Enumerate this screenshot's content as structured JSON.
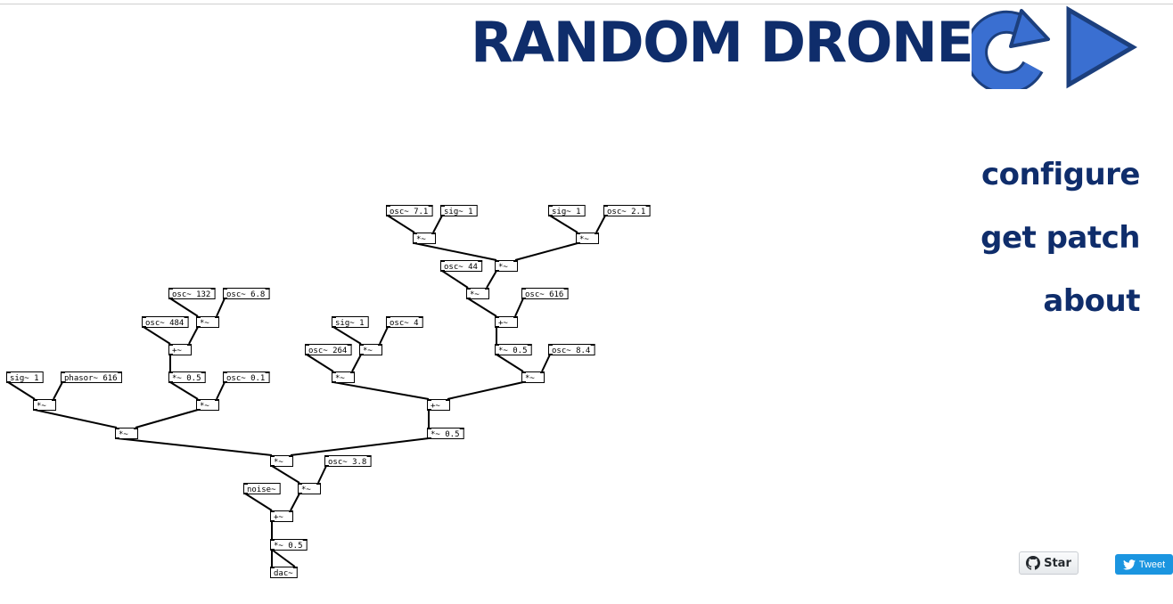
{
  "header": {
    "title": "RANDOM DRONE",
    "refresh_icon": "refresh-arrow-icon",
    "play_icon": "play-triangle-icon"
  },
  "nav": {
    "configure": "configure",
    "get_patch": "get patch",
    "about": "about"
  },
  "patch": {
    "boxes": [
      {
        "id": "b0",
        "label": "osc~ 7.1",
        "inlets": 2,
        "outlets": 1
      },
      {
        "id": "b1",
        "label": "sig~ 1",
        "inlets": 1,
        "outlets": 1
      },
      {
        "id": "b2",
        "label": "sig~ 1",
        "inlets": 1,
        "outlets": 1
      },
      {
        "id": "b3",
        "label": "osc~ 2.1",
        "inlets": 2,
        "outlets": 1
      },
      {
        "id": "b4",
        "label": "*~",
        "inlets": 2,
        "outlets": 1
      },
      {
        "id": "b5",
        "label": "*~",
        "inlets": 2,
        "outlets": 1
      },
      {
        "id": "b6",
        "label": "osc~ 44",
        "inlets": 2,
        "outlets": 1
      },
      {
        "id": "b7",
        "label": "*~",
        "inlets": 2,
        "outlets": 1
      },
      {
        "id": "b8",
        "label": "*~",
        "inlets": 2,
        "outlets": 1
      },
      {
        "id": "b9",
        "label": "osc~ 616",
        "inlets": 2,
        "outlets": 1
      },
      {
        "id": "b10",
        "label": "+~",
        "inlets": 2,
        "outlets": 1
      },
      {
        "id": "b11",
        "label": "*~ 0.5",
        "inlets": 2,
        "outlets": 1
      },
      {
        "id": "b12",
        "label": "osc~ 8.4",
        "inlets": 2,
        "outlets": 1
      },
      {
        "id": "b13",
        "label": "*~",
        "inlets": 2,
        "outlets": 1
      },
      {
        "id": "b14",
        "label": "osc~ 132",
        "inlets": 2,
        "outlets": 1
      },
      {
        "id": "b15",
        "label": "osc~ 6.8",
        "inlets": 2,
        "outlets": 1
      },
      {
        "id": "b16",
        "label": "osc~ 484",
        "inlets": 2,
        "outlets": 1
      },
      {
        "id": "b17",
        "label": "*~",
        "inlets": 2,
        "outlets": 1
      },
      {
        "id": "b18",
        "label": "+~",
        "inlets": 2,
        "outlets": 1
      },
      {
        "id": "b19",
        "label": "sig~ 1",
        "inlets": 1,
        "outlets": 1
      },
      {
        "id": "b20",
        "label": "osc~ 4",
        "inlets": 2,
        "outlets": 1
      },
      {
        "id": "b21",
        "label": "osc~ 264",
        "inlets": 2,
        "outlets": 1
      },
      {
        "id": "b22",
        "label": "*~",
        "inlets": 2,
        "outlets": 1
      },
      {
        "id": "b23",
        "label": "*~",
        "inlets": 2,
        "outlets": 1
      },
      {
        "id": "b24",
        "label": "sig~ 1",
        "inlets": 1,
        "outlets": 1
      },
      {
        "id": "b25",
        "label": "phasor~ 616",
        "inlets": 2,
        "outlets": 1
      },
      {
        "id": "b26",
        "label": "*~ 0.5",
        "inlets": 2,
        "outlets": 1
      },
      {
        "id": "b27",
        "label": "osc~ 0.1",
        "inlets": 2,
        "outlets": 1
      },
      {
        "id": "b28",
        "label": "*~",
        "inlets": 2,
        "outlets": 1
      },
      {
        "id": "b29",
        "label": "*~",
        "inlets": 2,
        "outlets": 1
      },
      {
        "id": "b30",
        "label": "+~",
        "inlets": 2,
        "outlets": 1
      },
      {
        "id": "b31",
        "label": "*~",
        "inlets": 2,
        "outlets": 1
      },
      {
        "id": "b32",
        "label": "*~ 0.5",
        "inlets": 2,
        "outlets": 1
      },
      {
        "id": "b33",
        "label": "*~",
        "inlets": 2,
        "outlets": 1
      },
      {
        "id": "b34",
        "label": "osc~ 3.8",
        "inlets": 2,
        "outlets": 1
      },
      {
        "id": "b35",
        "label": "*~",
        "inlets": 2,
        "outlets": 1
      },
      {
        "id": "b36",
        "label": "noise~",
        "inlets": 1,
        "outlets": 1
      },
      {
        "id": "b37",
        "label": "+~",
        "inlets": 2,
        "outlets": 1
      },
      {
        "id": "b38",
        "label": "*~ 0.5",
        "inlets": 2,
        "outlets": 1
      },
      {
        "id": "b39",
        "label": "dac~",
        "inlets": 2,
        "outlets": 0
      }
    ],
    "connections": [
      [
        "b0",
        0,
        "b4",
        0
      ],
      [
        "b1",
        0,
        "b4",
        1
      ],
      [
        "b2",
        0,
        "b5",
        0
      ],
      [
        "b3",
        0,
        "b5",
        1
      ],
      [
        "b4",
        0,
        "b7",
        0
      ],
      [
        "b5",
        0,
        "b7",
        1
      ],
      [
        "b6",
        0,
        "b8",
        0
      ],
      [
        "b7",
        0,
        "b8",
        1
      ],
      [
        "b8",
        0,
        "b10",
        0
      ],
      [
        "b9",
        0,
        "b10",
        1
      ],
      [
        "b10",
        0,
        "b11",
        0
      ],
      [
        "b11",
        0,
        "b13",
        0
      ],
      [
        "b12",
        0,
        "b13",
        1
      ],
      [
        "b14",
        0,
        "b17",
        0
      ],
      [
        "b15",
        0,
        "b17",
        1
      ],
      [
        "b16",
        0,
        "b18",
        0
      ],
      [
        "b17",
        0,
        "b18",
        1
      ],
      [
        "b18",
        0,
        "b26",
        0
      ],
      [
        "b19",
        0,
        "b22",
        0
      ],
      [
        "b20",
        0,
        "b22",
        1
      ],
      [
        "b21",
        0,
        "b23",
        0
      ],
      [
        "b22",
        0,
        "b23",
        1
      ],
      [
        "b24",
        0,
        "b28",
        0
      ],
      [
        "b25",
        0,
        "b28",
        1
      ],
      [
        "b26",
        0,
        "b29",
        0
      ],
      [
        "b27",
        0,
        "b29",
        1
      ],
      [
        "b23",
        0,
        "b30",
        0
      ],
      [
        "b13",
        0,
        "b30",
        1
      ],
      [
        "b28",
        0,
        "b31",
        0
      ],
      [
        "b29",
        0,
        "b31",
        1
      ],
      [
        "b30",
        0,
        "b32",
        0
      ],
      [
        "b31",
        0,
        "b33",
        0
      ],
      [
        "b32",
        0,
        "b33",
        1
      ],
      [
        "b33",
        0,
        "b35",
        0
      ],
      [
        "b34",
        0,
        "b35",
        1
      ],
      [
        "b36",
        0,
        "b37",
        0
      ],
      [
        "b35",
        0,
        "b37",
        1
      ],
      [
        "b37",
        0,
        "b38",
        0
      ],
      [
        "b38",
        0,
        "b39",
        0
      ],
      [
        "b38",
        0,
        "b39",
        1
      ]
    ]
  },
  "social": {
    "star_label": "Star",
    "star_icon": "github-icon",
    "tweet_label": "Tweet",
    "tweet_icon": "twitter-bird-icon"
  },
  "colors": {
    "title": "#0f2d6b",
    "icon_fill": "#3a6fd1",
    "icon_stroke": "#1c3f7d",
    "tweet_bg": "#1b95e0"
  }
}
